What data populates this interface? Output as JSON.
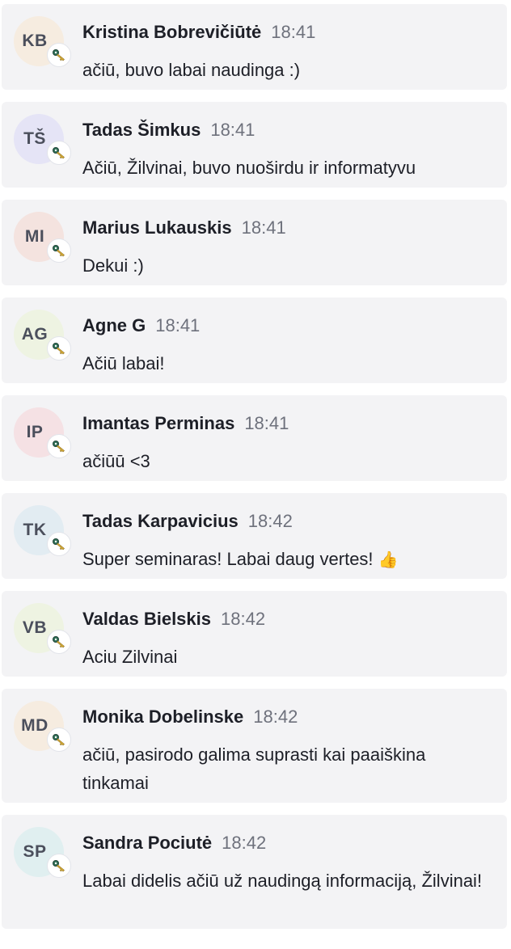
{
  "messages": [
    {
      "initials": "KB",
      "avatar_color": "#f6ece0",
      "name": "Kristina Bobrevičiūtė",
      "time": "18:41",
      "text": "ačiū, buvo labai naudinga :)"
    },
    {
      "initials": "TŠ",
      "avatar_color": "#e5e4f6",
      "name": "Tadas Šimkus",
      "time": "18:41",
      "text": "Ačiū, Žilvinai, buvo nuoširdu ir informatyvu"
    },
    {
      "initials": "MI",
      "avatar_color": "#f4e3df",
      "name": "Marius Lukauskis",
      "time": "18:41",
      "text": "Dekui :)"
    },
    {
      "initials": "AG",
      "avatar_color": "#eef3e2",
      "name": "Agne G",
      "time": "18:41",
      "text": "Ačiū labai!"
    },
    {
      "initials": "IP",
      "avatar_color": "#f5e1e4",
      "name": "Imantas Perminas",
      "time": "18:41",
      "text": "ačiūū <3"
    },
    {
      "initials": "TK",
      "avatar_color": "#e2ecf2",
      "name": "Tadas Karpavicius",
      "time": "18:42",
      "text": "Super seminaras! Labai daug vertes!",
      "emoji": "👍"
    },
    {
      "initials": "VB",
      "avatar_color": "#eef3e2",
      "name": "Valdas Bielskis",
      "time": "18:42",
      "text": "Aciu Zilvinai"
    },
    {
      "initials": "MD",
      "avatar_color": "#f6ece0",
      "name": "Monika Dobelinske",
      "time": "18:42",
      "text": "ačiū, pasirodo galima suprasti kai paaiškina tinkamai"
    },
    {
      "initials": "SP",
      "avatar_color": "#e0eff0",
      "name": "Sandra Pociutė",
      "time": "18:42",
      "text": "Labai didelis ačiū už naudingą informaciją, Žilvinai!"
    }
  ],
  "badge_icon": "key-icon"
}
